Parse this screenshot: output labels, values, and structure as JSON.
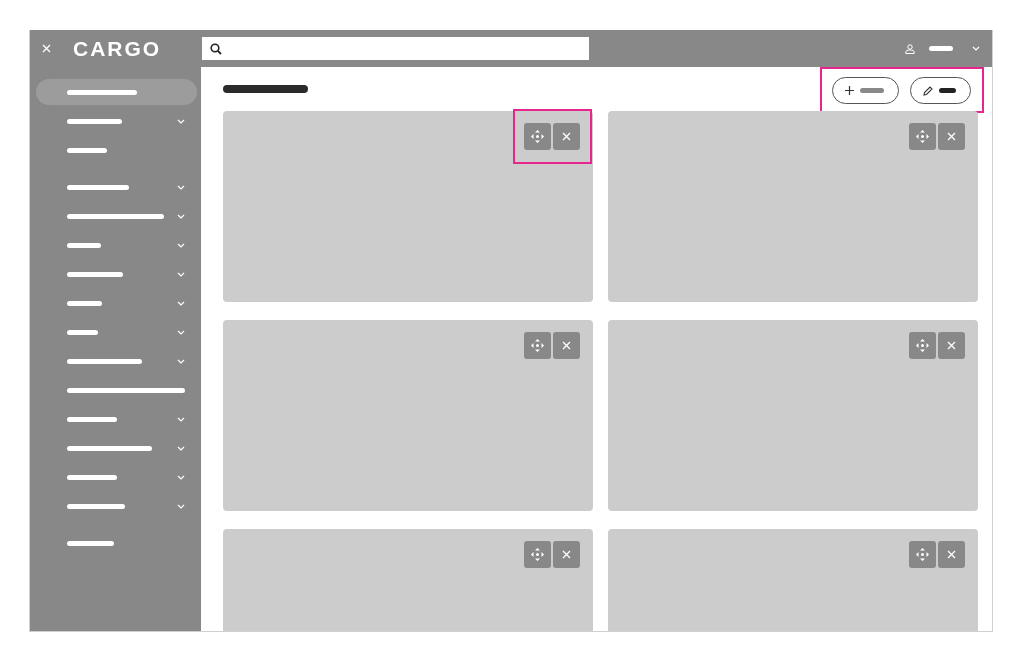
{
  "header": {
    "logo": "CARGO"
  },
  "sidebar": {
    "sections": [
      {
        "items": [
          {
            "selected": true,
            "expandable": false
          },
          {
            "selected": false,
            "expandable": true
          },
          {
            "selected": false,
            "expandable": false
          }
        ]
      },
      {
        "items": [
          {
            "selected": false,
            "expandable": true
          },
          {
            "selected": false,
            "expandable": true
          },
          {
            "selected": false,
            "expandable": true
          },
          {
            "selected": false,
            "expandable": true
          },
          {
            "selected": false,
            "expandable": true
          },
          {
            "selected": false,
            "expandable": true
          },
          {
            "selected": false,
            "expandable": true
          },
          {
            "selected": false,
            "expandable": false
          },
          {
            "selected": false,
            "expandable": true
          },
          {
            "selected": false,
            "expandable": true
          },
          {
            "selected": false,
            "expandable": true
          },
          {
            "selected": false,
            "expandable": true
          }
        ]
      },
      {
        "items": [
          {
            "selected": false,
            "expandable": false
          }
        ]
      }
    ]
  },
  "toolbar": {
    "highlighted": true,
    "buttons": [
      {
        "kind": "add"
      },
      {
        "kind": "edit"
      }
    ]
  },
  "cards": [
    {
      "highlighted": true
    },
    {
      "highlighted": false
    },
    {
      "highlighted": false
    },
    {
      "highlighted": false
    },
    {
      "highlighted": false
    },
    {
      "highlighted": false
    }
  ]
}
